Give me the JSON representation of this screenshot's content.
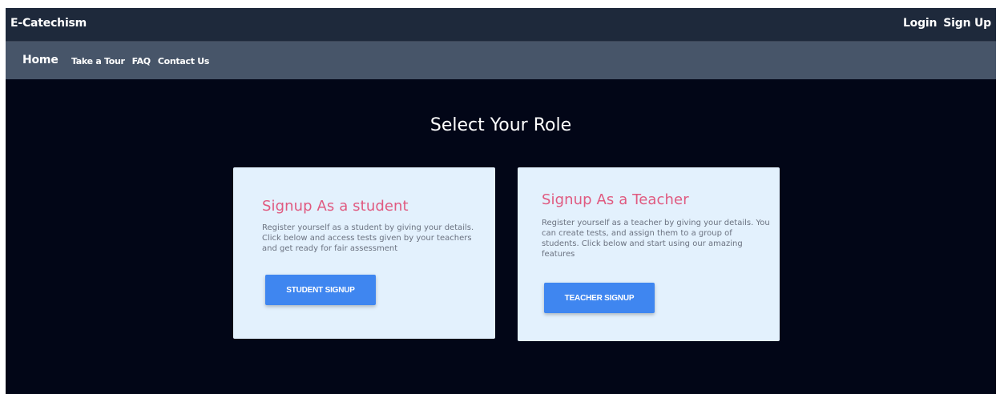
{
  "header": {
    "brand": "E-Catechism",
    "login": "Login",
    "signup": "Sign Up"
  },
  "nav": {
    "home": "Home",
    "links": [
      "Take a Tour",
      "FAQ",
      "Contact Us"
    ]
  },
  "main": {
    "title": "Select Your Role",
    "cards": [
      {
        "heading": "Signup As a student",
        "body": "Register yourself as a student by giving your details. Click below and access tests given by your teachers and get ready for fair assessment",
        "button": "STUDENT SIGNUP"
      },
      {
        "heading": "Signup As a Teacher",
        "body": "Register yourself as a teacher by giving your details. You can create tests, and assign them to a group of students. Click below and start using our amazing features",
        "button": "TEACHER SIGNUP"
      }
    ]
  },
  "colors": {
    "topbar": "#1e293b",
    "navbar": "#475569",
    "background": "#020617",
    "card": "#e3f1fd",
    "heading_accent": "#e05a80",
    "button": "#3f86f0"
  }
}
